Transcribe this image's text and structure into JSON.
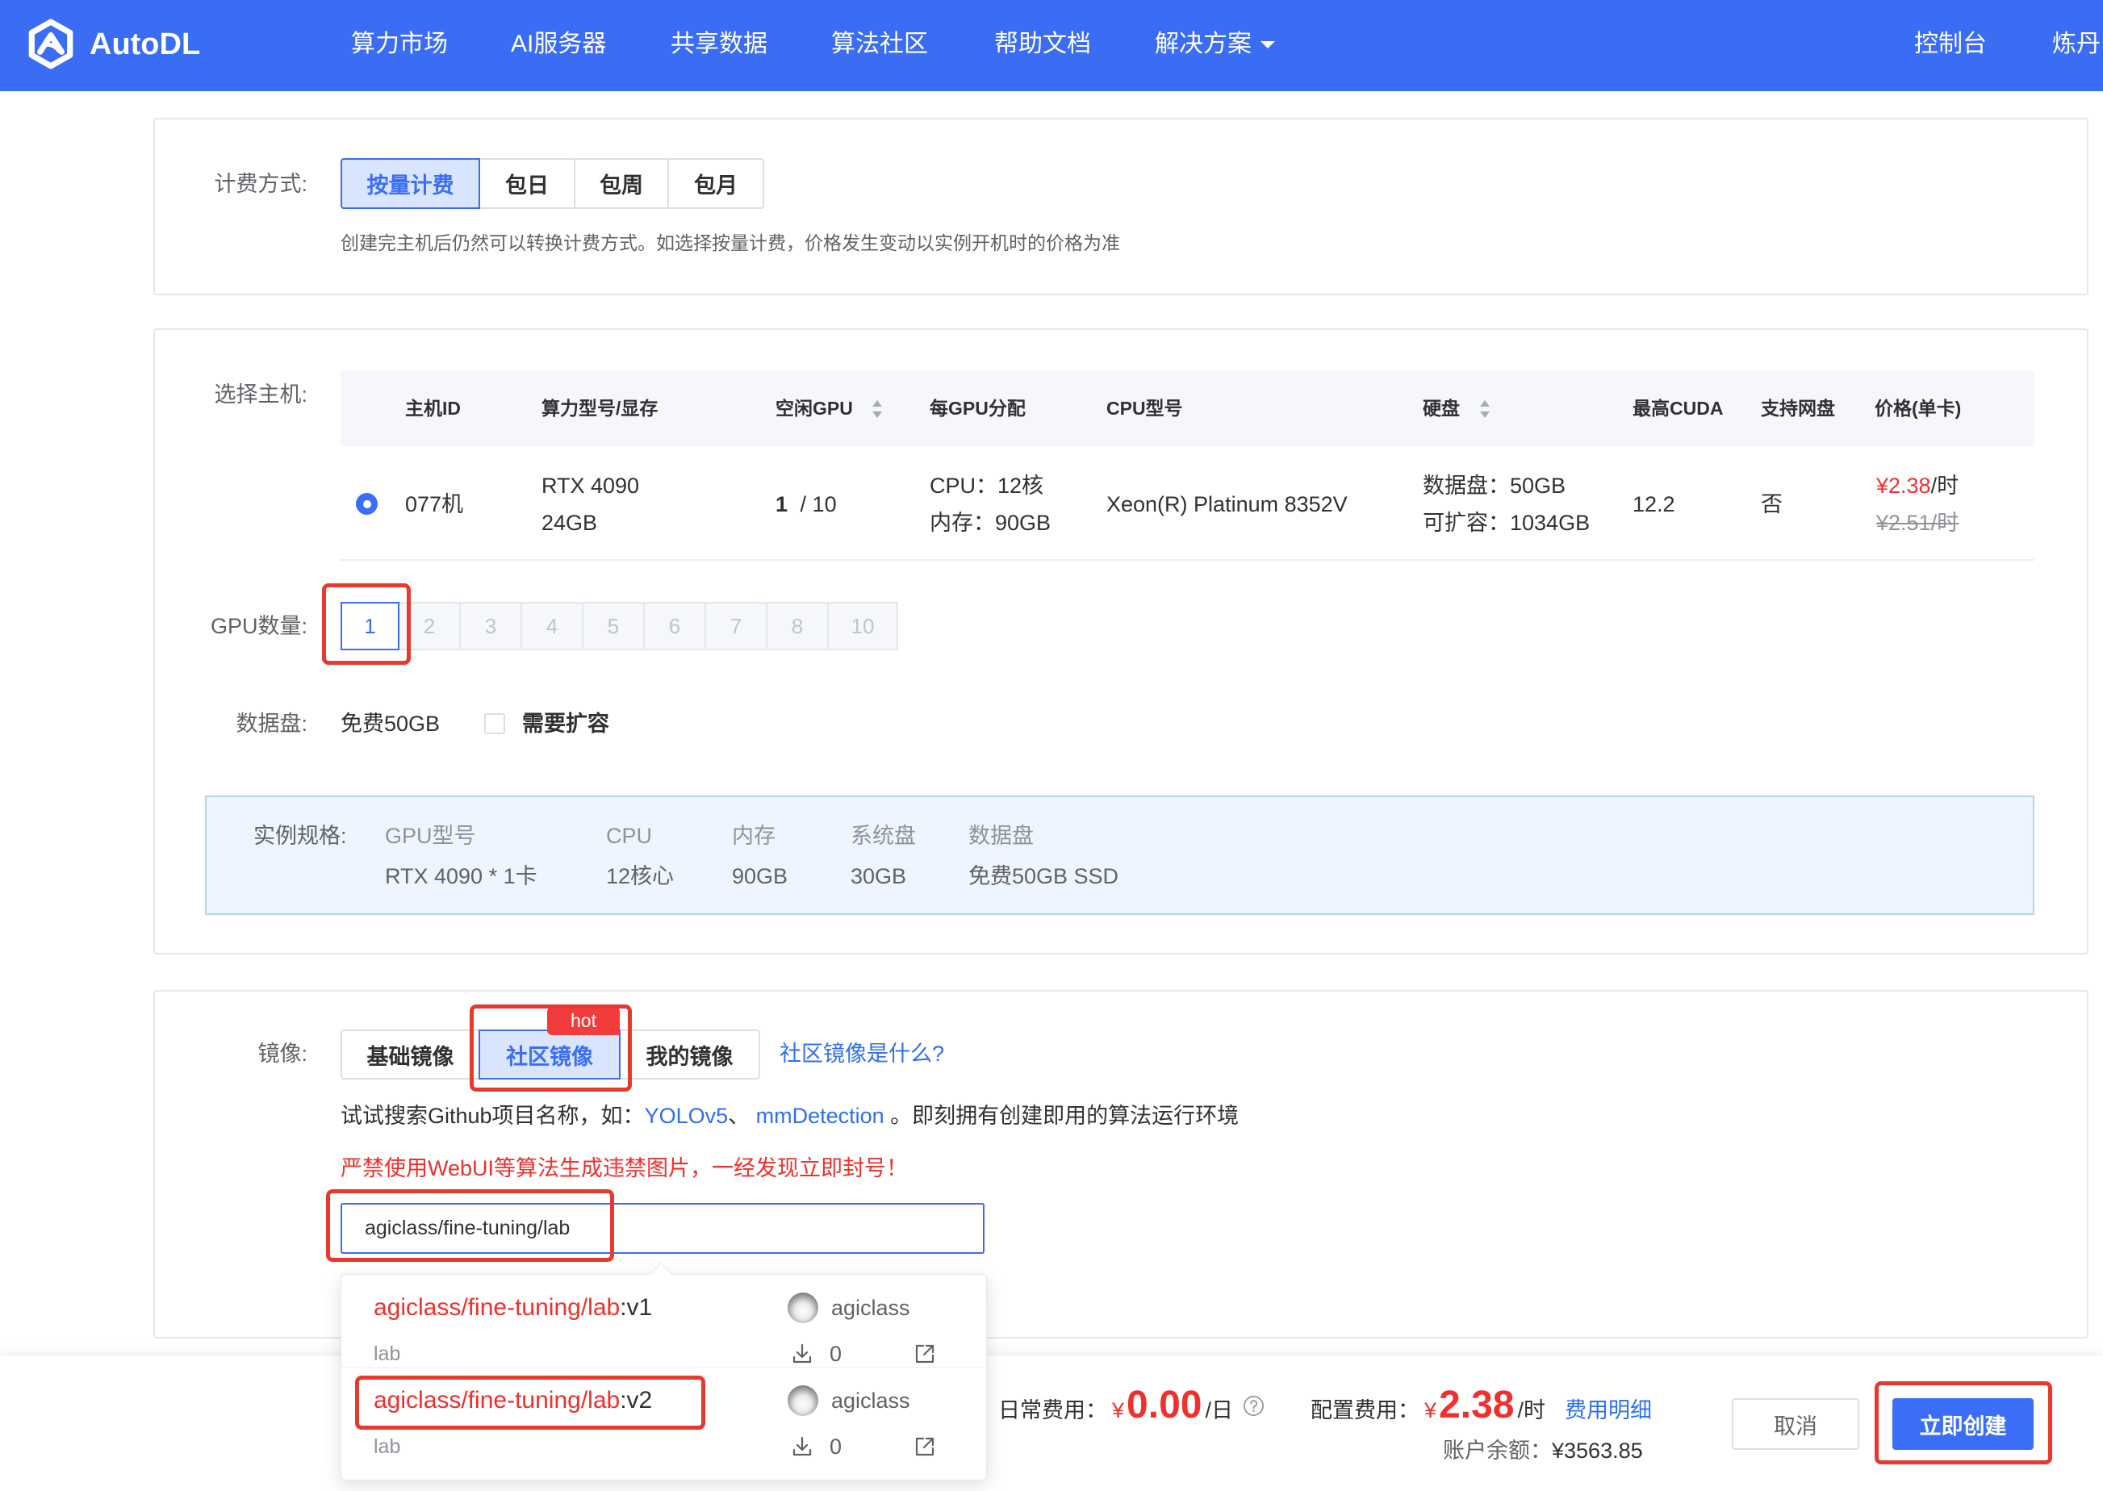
{
  "colors": {
    "primary": "#3b6ef6",
    "header": "#3a6cf4",
    "danger": "#f0302c",
    "highlight": "#e8392e"
  },
  "icons": {
    "logo": "autodl-logo-icon",
    "caret": "chevron-down-icon",
    "sort": "sort-icon",
    "help": "help-circle-icon",
    "download": "download-icon",
    "external": "external-link-icon"
  },
  "header": {
    "logo_text": "AutoDL",
    "nav": [
      "算力市场",
      "AI服务器",
      "共享数据",
      "算法社区",
      "帮助文档",
      "解决方案"
    ],
    "console": "控制台",
    "user": "炼丹"
  },
  "billing": {
    "label": "计费方式:",
    "options": [
      "按量计费",
      "包日",
      "包周",
      "包月"
    ],
    "selected_index": 0,
    "hint": "创建完主机后仍然可以转换计费方式。如选择按量计费，价格发生变动以实例开机时的价格为准"
  },
  "host": {
    "label": "选择主机:",
    "columns": [
      "主机ID",
      "算力型号/显存",
      "空闲GPU",
      "每GPU分配",
      "CPU型号",
      "硬盘",
      "最高CUDA",
      "支持网盘",
      "价格(单卡)"
    ],
    "rows": [
      {
        "selected": true,
        "id": "077机",
        "gpu_model": "RTX 4090",
        "gpu_mem": "24GB",
        "free_gpu": "1",
        "total_gpu": "/ 10",
        "cpu": "CPU：12核",
        "mem": "内存：90GB",
        "cpu_model": "Xeon(R) Platinum 8352V",
        "disk": "数据盘：50GB",
        "disk_expand": "可扩容：1034GB",
        "cuda": "12.2",
        "net_disk": "否",
        "price": "¥2.38",
        "price_unit": "/时",
        "original_price": "¥2.51/时"
      }
    ]
  },
  "gpu_count": {
    "label": "GPU数量:",
    "options": [
      "1",
      "2",
      "3",
      "4",
      "5",
      "6",
      "7",
      "8",
      "10"
    ],
    "selected_index": 0
  },
  "data_disk": {
    "label": "数据盘:",
    "free": "免费50GB",
    "expand_label": "需要扩容",
    "expand_checked": false
  },
  "spec": {
    "label": "实例规格:",
    "items": [
      {
        "key": "GPU型号",
        "value": "RTX 4090 * 1卡"
      },
      {
        "key": "CPU",
        "value": "12核心"
      },
      {
        "key": "内存",
        "value": "90GB"
      },
      {
        "key": "系统盘",
        "value": "30GB"
      },
      {
        "key": "数据盘",
        "value": "免费50GB SSD"
      }
    ]
  },
  "image": {
    "label": "镜像:",
    "tabs": [
      "基础镜像",
      "社区镜像",
      "我的镜像"
    ],
    "selected_index": 1,
    "hot_badge": "hot",
    "what_is_link": "社区镜像是什么?",
    "tip": {
      "prefix": "试试搜索Github项目名称，如：",
      "example_1": "YOLOv5",
      "separator": "、 ",
      "example_2": "mmDetection",
      "suffix": " 。即刻拥有创建即用的算法运行环境"
    },
    "warning": "严禁使用WebUI等算法生成违禁图片，一经发现立即封号！",
    "search": {
      "value": "agiclass/fine-tuning/lab"
    },
    "results": [
      {
        "match": "agiclass/fine-tuning/lab",
        "tag": ":v1",
        "author": "agiclass",
        "desc": "lab",
        "downloads": "0"
      },
      {
        "match": "agiclass/fine-tuning/lab",
        "tag": ":v2",
        "author": "agiclass",
        "desc": "lab",
        "downloads": "0"
      }
    ]
  },
  "footer": {
    "daily_label": "日常费用：",
    "daily_currency": "¥",
    "daily_value": "0.00",
    "daily_unit": "/日",
    "config_label": "配置费用：",
    "config_currency": "¥",
    "config_value": "2.38",
    "config_unit": "/时",
    "detail_link": "费用明细",
    "balance_label": "账户余额：",
    "balance_value": "¥3563.85",
    "cancel": "取消",
    "create": "立即创建"
  }
}
